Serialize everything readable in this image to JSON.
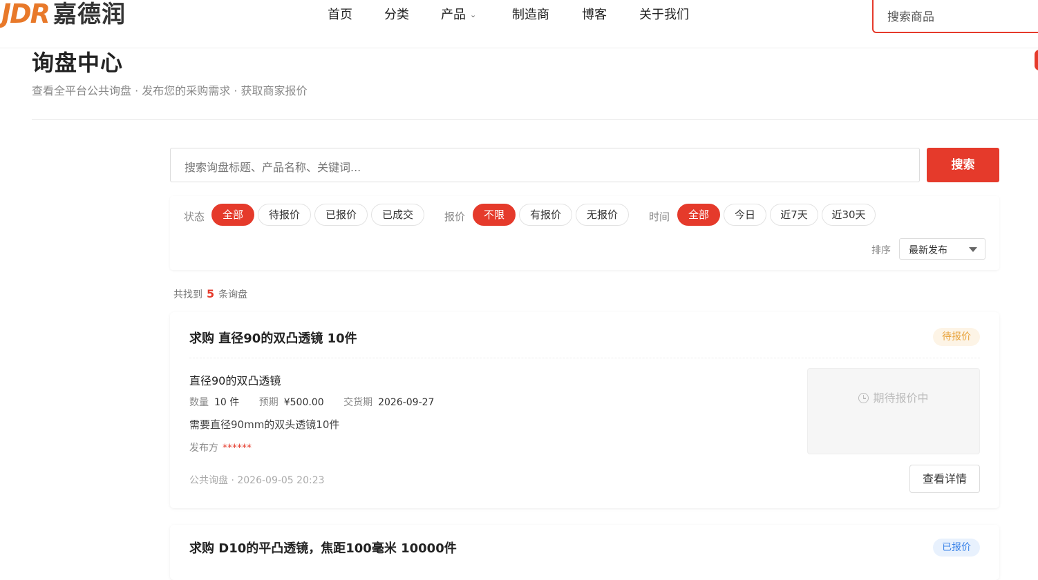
{
  "brand": {
    "mark": "JDR",
    "name": "嘉德润",
    "brand_color": "#e8792a"
  },
  "nav": {
    "items": [
      "首页",
      "分类",
      "产品",
      "制造商",
      "博客",
      "关于我们"
    ],
    "search_placeholder": "搜索商品"
  },
  "page": {
    "title": "询盘中心",
    "subtitle": "查看全平台公共询盘 · 发布您的采购需求 · 获取商家报价"
  },
  "search": {
    "placeholder": "搜索询盘标题、产品名称、关键词...",
    "button": "搜索"
  },
  "filters": {
    "status": {
      "label": "状态",
      "options": [
        "全部",
        "待报价",
        "已报价",
        "已成交"
      ],
      "active": "全部"
    },
    "quote": {
      "label": "报价",
      "options": [
        "不限",
        "有报价",
        "无报价"
      ],
      "active": "不限"
    },
    "time": {
      "label": "时间",
      "options": [
        "全部",
        "今日",
        "近7天",
        "近30天"
      ],
      "active": "全部"
    },
    "sort": {
      "label": "排序",
      "value": "最新发布"
    }
  },
  "results": {
    "prefix": "共找到",
    "count": "5",
    "suffix": "条询盘"
  },
  "cards": [
    {
      "title": "求购 直径90的双凸透镜 10件",
      "status": "待报价",
      "product": "直径90的双凸透镜",
      "qty_label": "数量",
      "qty": "10 件",
      "budget_label": "预期",
      "budget": "¥500.00",
      "delivery_label": "交货期",
      "delivery": "2026-09-27",
      "description": "需要直径90mm的双头透镜10件",
      "publisher_label": "发布方",
      "publisher": "******",
      "footer": "公共询盘 · 2026-09-05 20:23",
      "quote_status": "期待报价中",
      "detail_button": "查看详情"
    },
    {
      "title": "求购 D10的平凸透镜，焦距100毫米 10000件",
      "status": "已报价"
    }
  ],
  "colors": {
    "accent": "#e53a2b",
    "pending": "#e8a23a",
    "quoted": "#3a82e8"
  }
}
